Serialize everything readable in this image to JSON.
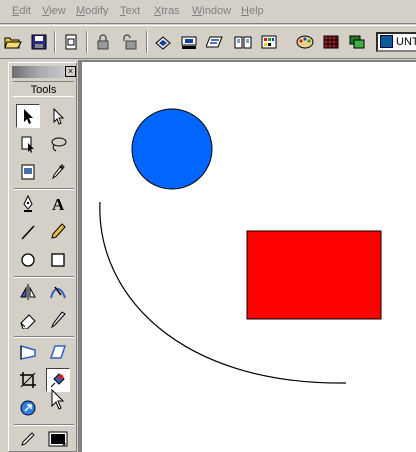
{
  "menubar": {
    "items": [
      {
        "label": "Edit",
        "mnemonic": "E",
        "rest": "dit"
      },
      {
        "label": "View",
        "mnemonic": "V",
        "rest": "iew"
      },
      {
        "label": "Modify",
        "mnemonic": "M",
        "rest": "odify"
      },
      {
        "label": "Text",
        "mnemonic": "T",
        "rest": "ext"
      },
      {
        "label": "Xtras",
        "mnemonic": "X",
        "rest": "tras"
      },
      {
        "label": "Window",
        "mnemonic": "W",
        "rest": "indow"
      },
      {
        "label": "Help",
        "mnemonic": "H",
        "rest": "elp"
      }
    ]
  },
  "toolbar": {
    "buttons": [
      "open-icon",
      "save-icon",
      "import-icon",
      "lock-icon",
      "unlock-icon",
      "align-icon",
      "transform-icon",
      "text-block-icon",
      "pages-icon",
      "color-wheel-icon",
      "grid-icon",
      "layers-icon"
    ],
    "document_name": "UNT"
  },
  "tools_panel": {
    "title": "Tools",
    "tools": [
      "pointer-icon",
      "subselect-icon",
      "page-icon",
      "lasso-icon",
      "trace-icon",
      "eyedropper-icon",
      "pen-icon",
      "text-icon",
      "line-icon",
      "pencil-icon",
      "ellipse-icon",
      "rectangle-icon",
      "reflect-icon",
      "freeform-icon",
      "eraser-icon",
      "knife-icon",
      "perspective-icon",
      "skew-icon",
      "crop-icon",
      "paint-bucket-icon",
      "link-icon"
    ],
    "stroke_label": "stroke-color"
  },
  "canvas": {
    "shapes": [
      {
        "kind": "circle",
        "fill": "#0066ff",
        "stroke": "#000000"
      },
      {
        "kind": "rectangle",
        "fill": "#ff0000",
        "stroke": "#000000"
      },
      {
        "kind": "arc",
        "stroke": "#000000"
      }
    ]
  },
  "colors": {
    "chrome": "#d4d0c8",
    "disabled_text": "#808080",
    "accent_blue": "#0066ff",
    "accent_red": "#ff0000"
  }
}
